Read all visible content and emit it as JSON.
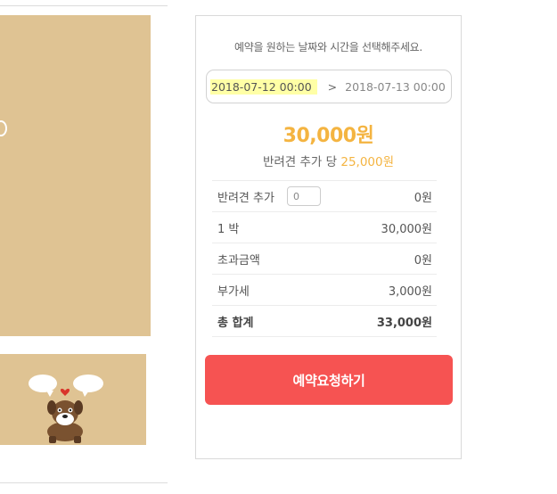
{
  "booking": {
    "instruction": "예약을 원하는 날짜와 시간을 선택해주세요.",
    "date_start": "2018-07-12 00:00",
    "date_separator": ">",
    "date_end": "2018-07-13 00:00",
    "price": "30,000원",
    "pet_extra_label": "반려견 추가 당",
    "pet_extra_price": "25,000원",
    "breakdown": [
      {
        "label": "반려견 추가",
        "value": "0원"
      },
      {
        "label": "1 박",
        "value": "30,000원"
      },
      {
        "label": "초과금액",
        "value": "0원"
      },
      {
        "label": "부가세",
        "value": "3,000원"
      },
      {
        "label": "총 합계",
        "value": "33,000원"
      }
    ],
    "pet_count_value": "0",
    "reserve_button": "예약요청하기"
  },
  "colors": {
    "accent_price": "#f4b441",
    "button": "#f65352",
    "date_highlight": "#ffffa6",
    "photo_bg": "#dfc393"
  }
}
